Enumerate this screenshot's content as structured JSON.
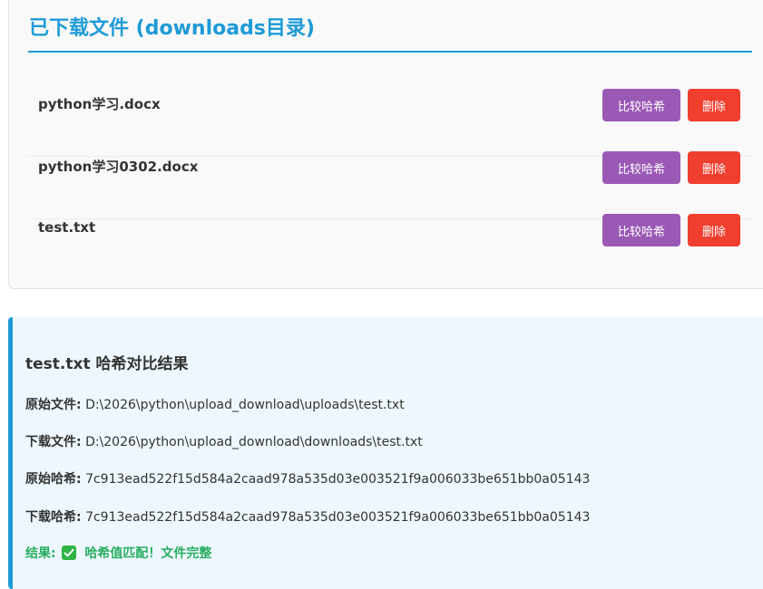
{
  "downloads": {
    "title": "已下载文件 (downloads目录)",
    "files": [
      {
        "name": "python学习.docx",
        "compare_label": "比较哈希",
        "delete_label": "删除"
      },
      {
        "name": "python学习0302.docx",
        "compare_label": "比较哈希",
        "delete_label": "删除"
      },
      {
        "name": "test.txt",
        "compare_label": "比较哈希",
        "delete_label": "删除"
      }
    ]
  },
  "result": {
    "title": "test.txt 哈希对比结果",
    "original_file_label": "原始文件:",
    "original_file_value": "D:\\2026\\python\\upload_download\\uploads\\test.txt",
    "downloaded_file_label": "下载文件:",
    "downloaded_file_value": "D:\\2026\\python\\upload_download\\downloads\\test.txt",
    "original_hash_label": "原始哈希:",
    "original_hash_value": "7c913ead522f15d584a2caad978a535d03e003521f9a006033be651bb0a05143",
    "downloaded_hash_label": "下载哈希:",
    "downloaded_hash_value": "7c913ead522f15d584a2caad978a535d03e003521f9a006033be651bb0a05143",
    "result_label": "结果:",
    "result_icon": "check-mark-icon",
    "result_text": "哈希值匹配！文件完整",
    "match_color": "#27ae60"
  },
  "colors": {
    "accent": "#1e9bd7",
    "compare_button": "#9b59b6",
    "delete_button": "#f03e2f"
  }
}
